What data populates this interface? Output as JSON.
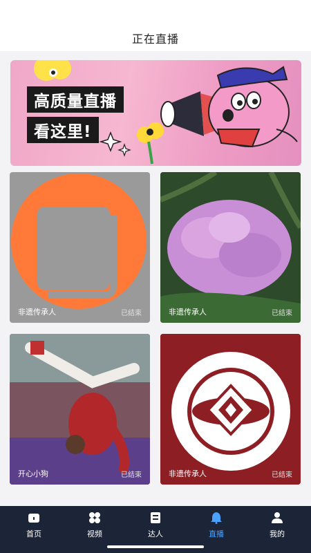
{
  "header": {
    "title": "正在直播"
  },
  "banner": {
    "line1": "高质量直播",
    "line2": "看这里!"
  },
  "cards": [
    {
      "label": "非遗传承人",
      "status": "已结束"
    },
    {
      "label": "非遗传承人",
      "status": "已结束"
    },
    {
      "label": "开心小狗",
      "status": "已结束"
    },
    {
      "label": "非遗传承人",
      "status": "已结束"
    }
  ],
  "tabs": [
    {
      "label": "首页",
      "icon": "home-icon"
    },
    {
      "label": "视频",
      "icon": "grid-icon"
    },
    {
      "label": "达人",
      "icon": "profile-card-icon"
    },
    {
      "label": "直播",
      "icon": "bell-icon"
    },
    {
      "label": "我的",
      "icon": "user-icon"
    }
  ],
  "colors": {
    "tabbar_bg": "#1c2538",
    "accent": "#4aa3ff"
  }
}
